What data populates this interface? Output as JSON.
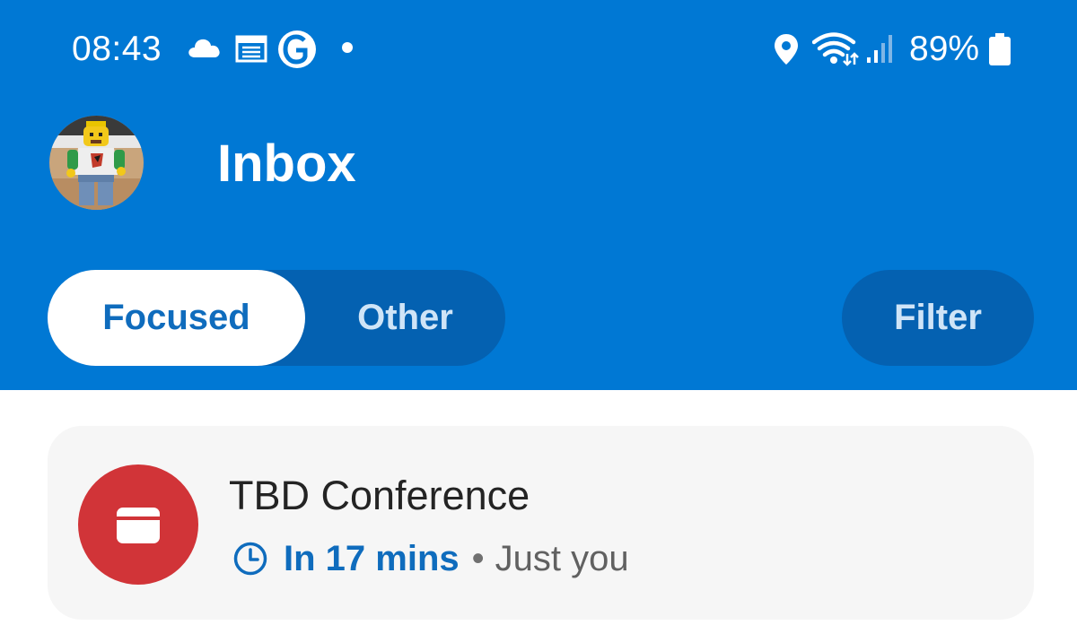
{
  "status_bar": {
    "time": "08:43",
    "battery_percent": "89%",
    "battery_level": 0.89,
    "left_icons": [
      "cloud-icon",
      "calendar-notification-icon",
      "guardian-app-icon",
      "notification-dot-icon"
    ],
    "right_icons": [
      "location-icon",
      "wifi-icon",
      "signal-icon",
      "battery-icon"
    ]
  },
  "header": {
    "title": "Inbox",
    "background_color": "#0078d4"
  },
  "tabs": [
    {
      "label": "Focused",
      "selected": true
    },
    {
      "label": "Other",
      "selected": false
    }
  ],
  "filter": {
    "label": "Filter"
  },
  "event": {
    "title": "TBD Conference",
    "time": "In 17 mins",
    "separator": "•",
    "attendees": "Just you",
    "icon_color": "#d13438",
    "time_color": "#0f6cbd"
  }
}
